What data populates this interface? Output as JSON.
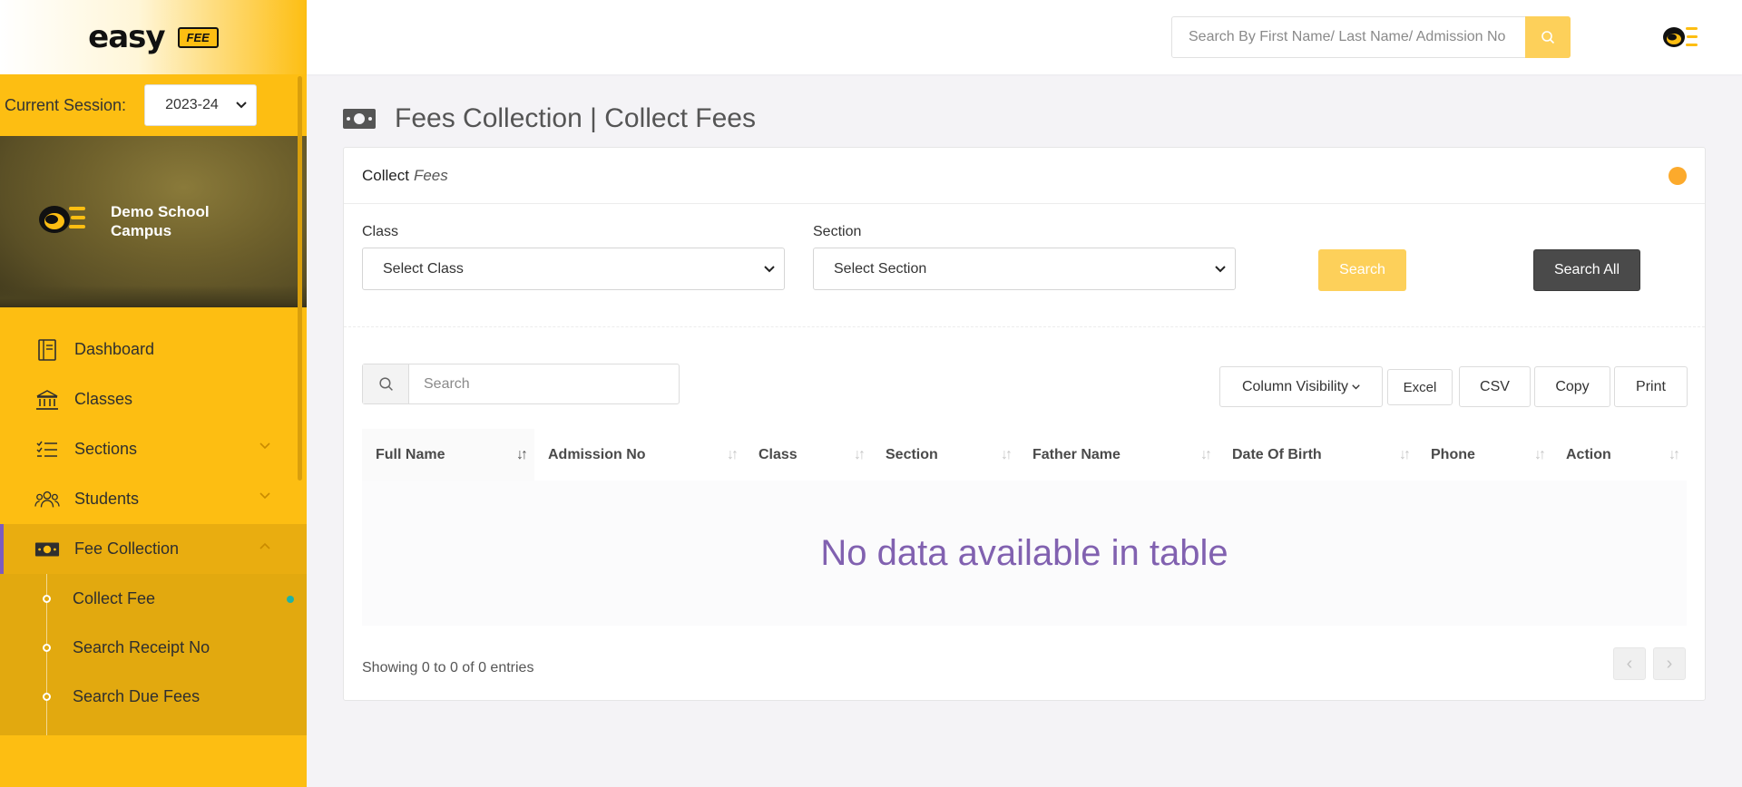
{
  "brand": {
    "name": "easy",
    "tag": "FEE"
  },
  "session": {
    "label": "Current Session:",
    "value": "2023-24"
  },
  "campus": {
    "name": "Demo School Campus"
  },
  "sidebar": {
    "items": [
      {
        "label": "Dashboard",
        "icon": "book-icon"
      },
      {
        "label": "Classes",
        "icon": "institution-icon"
      },
      {
        "label": "Sections",
        "icon": "list-check-icon"
      },
      {
        "label": "Students",
        "icon": "users-icon"
      },
      {
        "label": "Fee Collection",
        "icon": "money-icon"
      }
    ],
    "submenu": [
      {
        "label": "Collect Fee"
      },
      {
        "label": "Search Receipt No"
      },
      {
        "label": "Search Due Fees"
      }
    ]
  },
  "topbar": {
    "search_placeholder": "Search By First Name/ Last Name/ Admission No"
  },
  "page": {
    "title": "Fees Collection | Collect Fees"
  },
  "card": {
    "title_bold": "Collect",
    "title_italic": "Fees",
    "class_label": "Class",
    "class_value": "Select Class",
    "section_label": "Section",
    "section_value": "Select Section",
    "search_btn": "Search",
    "search_all_btn": "Search All"
  },
  "table": {
    "search_placeholder": "Search",
    "buttons": {
      "column_visibility": "Column Visibility",
      "excel": "Excel",
      "csv": "CSV",
      "copy": "Copy",
      "print": "Print"
    },
    "columns": [
      "Full Name",
      "Admission No",
      "Class",
      "Section",
      "Father Name",
      "Date Of Birth",
      "Phone",
      "Action"
    ],
    "empty": "No data available in table",
    "info": "Showing 0 to 0 of 0 entries"
  },
  "colors": {
    "sidebar": "#fdbe12",
    "accent_purple": "#8161b0",
    "status_orange": "#fcaa2c",
    "search_btn": "#fdd05a"
  }
}
